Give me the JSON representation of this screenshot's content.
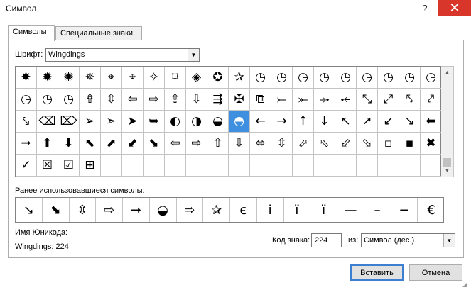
{
  "window": {
    "title": "Символ",
    "help_label": "?",
    "close_label": "✕"
  },
  "tabs": [
    {
      "label": "Символы",
      "active": true
    },
    {
      "label": "Специальные знаки",
      "active": false
    }
  ],
  "font": {
    "label": "Шрифт:",
    "value": "Wingdings"
  },
  "symbol_grid": {
    "selected_index": 50,
    "rows": [
      [
        "✸",
        "✹",
        "✺",
        "✵",
        "⌖",
        "⌖",
        "✧",
        "⌑",
        "◈",
        "✪",
        "✰",
        "◷",
        "◷",
        "◷",
        "◷",
        "◷",
        "◷",
        "◷",
        "◷",
        "◷"
      ],
      [
        "◷",
        "◷",
        "◷",
        "⇮",
        "⇳",
        "⇦",
        "⇨",
        "⇪",
        "⇩",
        "⇶",
        "✠",
        "⧉",
        "⤚",
        "⤜",
        "⤞",
        "⤝",
        "⤡",
        "⤢",
        "⤣",
        "⤤"
      ],
      [
        "⤥",
        "⌫",
        "⌦",
        "➢",
        "➣",
        "➤",
        "➥",
        "◐",
        "◑",
        "◒",
        "◓",
        "←",
        "→",
        "↑",
        "↓",
        "↖",
        "↗",
        "↙",
        "↘",
        "⬅"
      ],
      [
        "➞",
        "⬆",
        "⬇",
        "⬉",
        "⬈",
        "⬋",
        "⬊",
        "⇦",
        "⇨",
        "⇧",
        "⇩",
        "⬄",
        "⇳",
        "⬀",
        "⬁",
        "⬃",
        "⬂",
        "▫",
        "▪",
        "✖"
      ],
      [
        "✓",
        "☒",
        "☑",
        "⊞",
        "",
        "",
        "",
        "",
        "",
        "",
        "",
        "",
        "",
        "",
        "",
        "",
        "",
        "",
        "",
        ""
      ]
    ]
  },
  "recent": {
    "label": "Ранее использовавшиеся символы:",
    "items": [
      "←",
      "→",
      "←",
      "⇮",
      "↘",
      "⬊",
      "⇳",
      "⇨",
      "➞",
      "◒",
      "⇨",
      "✰",
      "є",
      "і",
      "ї",
      "ї",
      "—",
      "–",
      "−",
      "€"
    ]
  },
  "unicode": {
    "label": "Имя Юникода:",
    "value": "Wingdings: 224"
  },
  "code": {
    "label": "Код знака:",
    "value": "224",
    "from_label": "из:",
    "from_value": "Символ (дес.)"
  },
  "buttons": {
    "insert": "Вставить",
    "cancel": "Отмена"
  }
}
